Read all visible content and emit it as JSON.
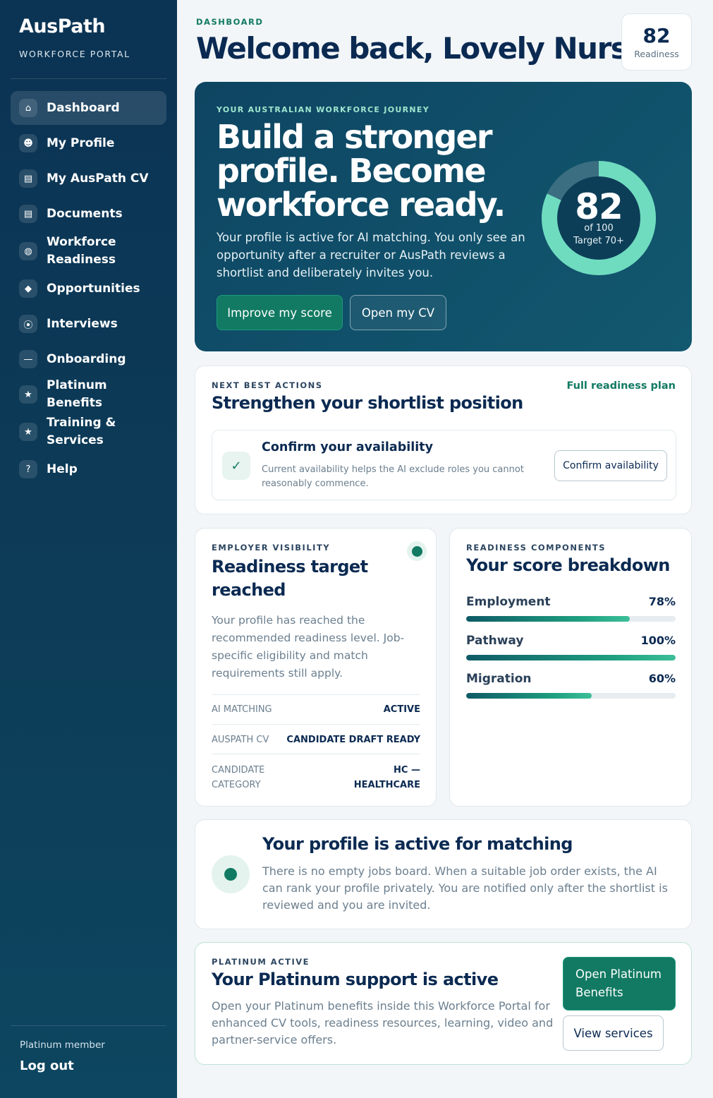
{
  "brand": {
    "name": "AusPath",
    "subtitle": "WORKFORCE PORTAL"
  },
  "nav": [
    {
      "label": "Dashboard",
      "icon": "home-icon",
      "glyph": "⌂",
      "active": true
    },
    {
      "label": "My Profile",
      "icon": "user-icon",
      "glyph": "☻"
    },
    {
      "label": "My AusPath CV",
      "icon": "cv-icon",
      "glyph": "▤"
    },
    {
      "label": "Documents",
      "icon": "document-icon",
      "glyph": "▤"
    },
    {
      "label": "Workforce Readiness",
      "icon": "readiness-icon",
      "glyph": "◍"
    },
    {
      "label": "Opportunities",
      "icon": "diamond-icon",
      "glyph": "◆"
    },
    {
      "label": "Interviews",
      "icon": "play-icon",
      "glyph": "⦿"
    },
    {
      "label": "Onboarding",
      "icon": "minus-icon",
      "glyph": "—"
    },
    {
      "label": "Platinum Benefits",
      "icon": "star-icon",
      "glyph": "★"
    },
    {
      "label": "Training & Services",
      "icon": "star-icon",
      "glyph": "★"
    },
    {
      "label": "Help",
      "icon": "help-icon",
      "glyph": "?"
    }
  ],
  "sidebar_footer": {
    "member": "Platinum member",
    "logout": "Log out"
  },
  "header": {
    "eyebrow": "DASHBOARD",
    "title": "Welcome back, Lovely Nurse",
    "score": "82",
    "score_label": "Readiness"
  },
  "hero": {
    "eyebrow": "YOUR AUSTRALIAN WORKFORCE JOURNEY",
    "title": "Build a stronger profile. Become workforce ready.",
    "text": "Your profile is active for AI matching. You only see an opportunity after a recruiter or AusPath reviews a shortlist and deliberately invites you.",
    "primary_button": "Improve my score",
    "secondary_button": "Open my CV",
    "ring": {
      "value": 82,
      "max": 100,
      "of_label": "of 100",
      "target_label": "Target 70+",
      "track_color": "#3a6e80",
      "fill_color": "#6fdcc0"
    }
  },
  "next_actions": {
    "eyebrow": "NEXT BEST ACTIONS",
    "title": "Strengthen your shortlist position",
    "link": "Full readiness plan",
    "item": {
      "check": "✓",
      "title": "Confirm your availability",
      "text": "Current availability helps the AI exclude roles you cannot reasonably commence.",
      "button": "Confirm availability"
    }
  },
  "visibility": {
    "eyebrow": "EMPLOYER VISIBILITY",
    "title": "Readiness target reached",
    "text": "Your profile has reached the recommended readiness level. Job-specific eligibility and match requirements still apply.",
    "rows": [
      {
        "key": "AI MATCHING",
        "value": "ACTIVE"
      },
      {
        "key": "AUSPATH CV",
        "value": "CANDIDATE DRAFT READY"
      },
      {
        "key": "CANDIDATE CATEGORY",
        "value": "HC — HEALTHCARE"
      }
    ]
  },
  "breakdown": {
    "eyebrow": "READINESS COMPONENTS",
    "title": "Your score breakdown",
    "items": [
      {
        "label": "Employment",
        "value": "78%",
        "pct": 78
      },
      {
        "label": "Pathway",
        "value": "100%",
        "pct": 100
      },
      {
        "label": "Migration",
        "value": "60%",
        "pct": 60
      }
    ]
  },
  "matching": {
    "title": "Your profile is active for matching",
    "text": "There is no empty jobs board. When a suitable job order exists, the AI can rank your profile privately. You are notified only after the shortlist is reviewed and you are invited."
  },
  "platinum": {
    "eyebrow": "PLATINUM ACTIVE",
    "title": "Your Platinum support is active",
    "text": "Open your Platinum benefits inside this Workforce Portal for enhanced CV tools, readiness resources, learning, video and partner-service offers.",
    "primary_button": "Open Platinum Benefits",
    "secondary_button": "View services"
  }
}
